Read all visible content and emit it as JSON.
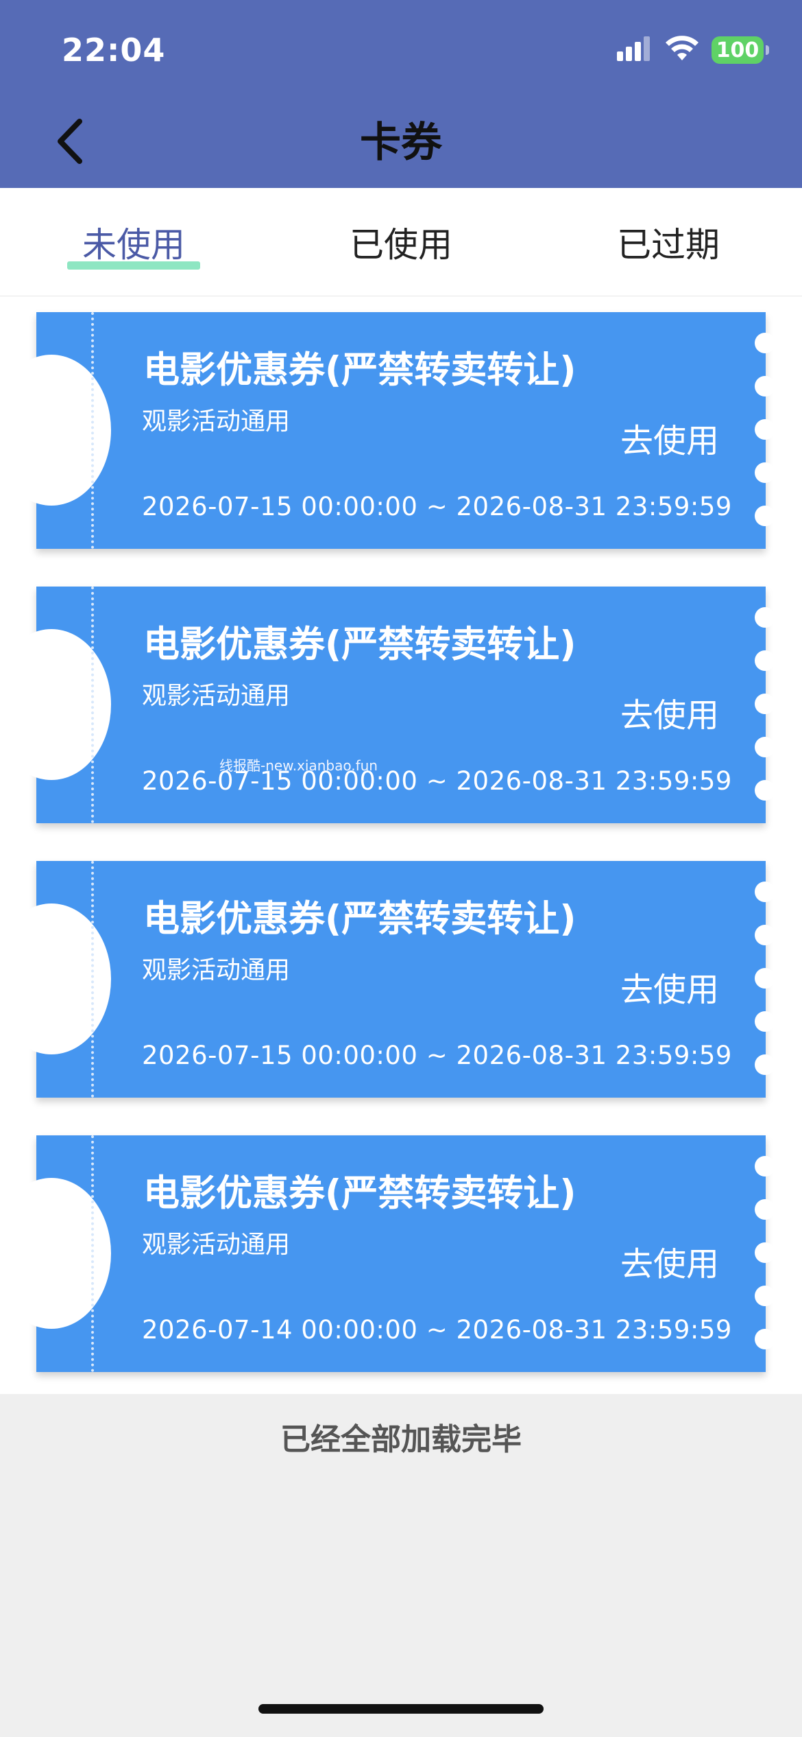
{
  "status_bar": {
    "time": "22:04",
    "battery": "100"
  },
  "header": {
    "title": "卡券"
  },
  "tabs": [
    {
      "label": "未使用",
      "active": true
    },
    {
      "label": "已使用",
      "active": false
    },
    {
      "label": "已过期",
      "active": false
    }
  ],
  "coupons": [
    {
      "title": "电影优惠券(严禁转卖转让)",
      "subtitle": "观影活动通用",
      "action": "去使用",
      "validity": "2026-07-15 00:00:00 ~ 2026-08-31 23:59:59"
    },
    {
      "title": "电影优惠券(严禁转卖转让)",
      "subtitle": "观影活动通用",
      "action": "去使用",
      "validity": "2026-07-15 00:00:00 ~ 2026-08-31 23:59:59"
    },
    {
      "title": "电影优惠券(严禁转卖转让)",
      "subtitle": "观影活动通用",
      "action": "去使用",
      "validity": "2026-07-15 00:00:00 ~ 2026-08-31 23:59:59"
    },
    {
      "title": "电影优惠券(严禁转卖转让)",
      "subtitle": "观影活动通用",
      "action": "去使用",
      "validity": "2026-07-14 00:00:00 ~ 2026-08-31 23:59:59"
    }
  ],
  "watermark": "线报酷-new.xianbao.fun",
  "footer": {
    "text": "已经全部加载完毕"
  },
  "colors": {
    "header": "#566bb6",
    "coupon": "#4696f0",
    "active_tab": "#4b5aa6",
    "tab_underline": "#8ee6c2"
  }
}
